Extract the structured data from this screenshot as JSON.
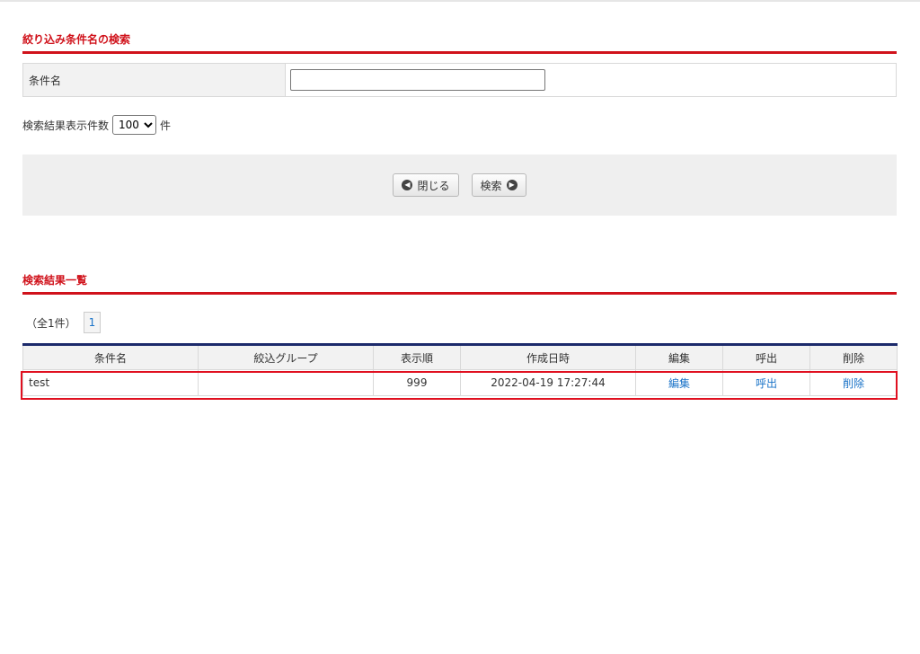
{
  "search_section": {
    "title": "絞り込み条件名の検索",
    "field_label": "条件名",
    "field_value": "",
    "field_placeholder": ""
  },
  "count": {
    "label_before": "検索結果表示件数",
    "selected": "100",
    "label_after": "件"
  },
  "buttons": {
    "close_label": "閉じる",
    "search_label": "検索"
  },
  "results_section": {
    "title": "検索結果一覧",
    "total_text": "（全1件）",
    "page": "1"
  },
  "table": {
    "headers": [
      "条件名",
      "絞込グループ",
      "表示順",
      "作成日時",
      "編集",
      "呼出",
      "削除"
    ],
    "rows": [
      {
        "name": "test",
        "group": "",
        "order": "999",
        "created": "2022-04-19 17:27:44",
        "edit": "編集",
        "call": "呼出",
        "delete": "削除"
      }
    ]
  },
  "colors": {
    "accent_red": "#d0121b",
    "table_header_border": "#1c2a6b",
    "link_blue": "#1a73c8",
    "highlight_box": "#e01020"
  }
}
